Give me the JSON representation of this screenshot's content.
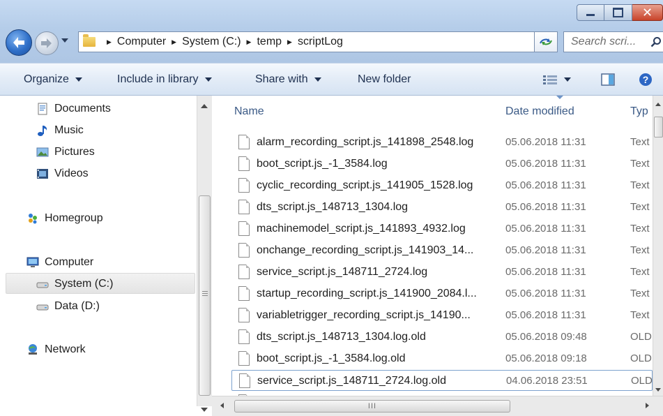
{
  "window": {
    "caption_buttons": [
      "minimize",
      "maximize",
      "close"
    ]
  },
  "navigation": {
    "breadcrumb": [
      "Computer",
      "System (C:)",
      "temp",
      "scriptLog"
    ],
    "search_placeholder": "Search scri..."
  },
  "toolbar": {
    "organize": "Organize",
    "include_in_library": "Include in library",
    "share_with": "Share with",
    "new_folder": "New folder"
  },
  "sidebar": {
    "items": [
      {
        "label": "Documents",
        "icon": "documents-icon"
      },
      {
        "label": "Music",
        "icon": "music-icon"
      },
      {
        "label": "Pictures",
        "icon": "pictures-icon"
      },
      {
        "label": "Videos",
        "icon": "videos-icon"
      },
      {
        "label": "Homegroup",
        "icon": "homegroup-icon"
      },
      {
        "label": "Computer",
        "icon": "computer-icon"
      },
      {
        "label": "System (C:)",
        "icon": "drive-icon",
        "selected": true
      },
      {
        "label": "Data (D:)",
        "icon": "drive-icon"
      },
      {
        "label": "Network",
        "icon": "network-icon"
      }
    ]
  },
  "file_list": {
    "columns": [
      "Name",
      "Date modified",
      "Typ"
    ],
    "rows": [
      {
        "name": "alarm_recording_script.js_141898_2548.log",
        "date": "05.06.2018 11:31",
        "type": "Text"
      },
      {
        "name": "boot_script.js_-1_3584.log",
        "date": "05.06.2018 11:31",
        "type": "Text"
      },
      {
        "name": "cyclic_recording_script.js_141905_1528.log",
        "date": "05.06.2018 11:31",
        "type": "Text"
      },
      {
        "name": "dts_script.js_148713_1304.log",
        "date": "05.06.2018 11:31",
        "type": "Text"
      },
      {
        "name": "machinemodel_script.js_141893_4932.log",
        "date": "05.06.2018 11:31",
        "type": "Text"
      },
      {
        "name": "onchange_recording_script.js_141903_14...",
        "date": "05.06.2018 11:31",
        "type": "Text"
      },
      {
        "name": "service_script.js_148711_2724.log",
        "date": "05.06.2018 11:31",
        "type": "Text"
      },
      {
        "name": "startup_recording_script.js_141900_2084.l...",
        "date": "05.06.2018 11:31",
        "type": "Text"
      },
      {
        "name": "variabletrigger_recording_script.js_14190...",
        "date": "05.06.2018 11:31",
        "type": "Text"
      },
      {
        "name": "dts_script.js_148713_1304.log.old",
        "date": "05.06.2018 09:48",
        "type": "OLD"
      },
      {
        "name": "boot_script.js_-1_3584.log.old",
        "date": "05.06.2018 09:18",
        "type": "OLD"
      },
      {
        "name": "service_script.js_148711_2724.log.old",
        "date": "04.06.2018 23:51",
        "type": "OLD",
        "selected": true
      }
    ]
  },
  "scrollbar": {
    "h_thumb_grip": "III"
  },
  "colors": {
    "title_gradient_top": "#c6daf2",
    "command_bar": "#e3ecf7",
    "header_text": "#3b5a86",
    "selection_border": "#7da2ce",
    "close_button": "#c8432a"
  }
}
